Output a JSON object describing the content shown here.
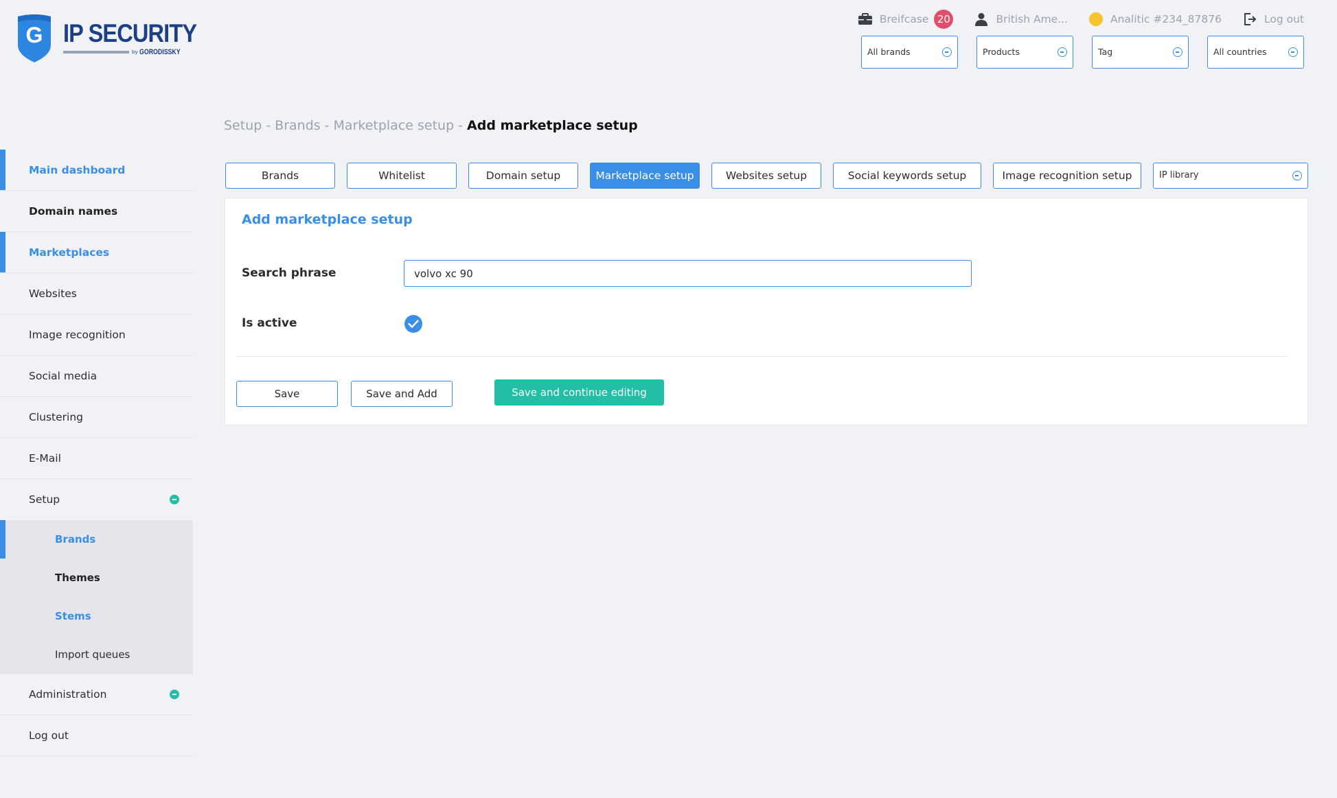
{
  "logo": {
    "letter": "G",
    "name": "IP SECURITY",
    "by": "by",
    "sub": "GORODISSKY"
  },
  "topbar": {
    "briefcase_label": "Breifcase",
    "briefcase_count": "20",
    "user_name": "British Ame...",
    "analytic": "Analitic #234_87876",
    "logout": "Log out"
  },
  "filters": [
    "All brands",
    "Products",
    "Tag",
    "All countries"
  ],
  "sidebar": {
    "items": [
      {
        "label": "Main dashboard"
      },
      {
        "label": "Domain names"
      },
      {
        "label": "Marketplaces"
      },
      {
        "label": "Websites"
      },
      {
        "label": "Image recognition"
      },
      {
        "label": "Social media"
      },
      {
        "label": "Clustering"
      },
      {
        "label": "E-Mail"
      },
      {
        "label": "Setup"
      },
      {
        "label": "Administration"
      },
      {
        "label": "Log out"
      }
    ],
    "setup_sub": [
      {
        "label": "Brands"
      },
      {
        "label": "Themes"
      },
      {
        "label": "Stems"
      },
      {
        "label": "Import queues"
      }
    ]
  },
  "breadcrumb": {
    "items": [
      "Setup",
      "Brands",
      "Marketplace setup"
    ],
    "separator": "-",
    "current": "Add marketplace setup"
  },
  "tabs": [
    {
      "label": "Brands"
    },
    {
      "label": "Whitelist"
    },
    {
      "label": "Domain setup"
    },
    {
      "label": "Marketplace setup"
    },
    {
      "label": "Websites setup"
    },
    {
      "label": "Social keywords setup"
    },
    {
      "label": "Image recognition setup"
    }
  ],
  "tab_select": {
    "value": "IP library"
  },
  "form": {
    "title": "Add marketplace setup",
    "search_label": "Search phrase",
    "search_value": "volvo xc 90",
    "active_label": "Is active",
    "save": "Save",
    "save_add": "Save and Add",
    "save_continue": "Save and continue editing"
  },
  "colors": {
    "accent": "#3a8ee6",
    "success": "#22bfa6",
    "badge": "#e0506c",
    "analytic_dot": "#f7c32e",
    "brand_navy": "#1d3f86"
  }
}
